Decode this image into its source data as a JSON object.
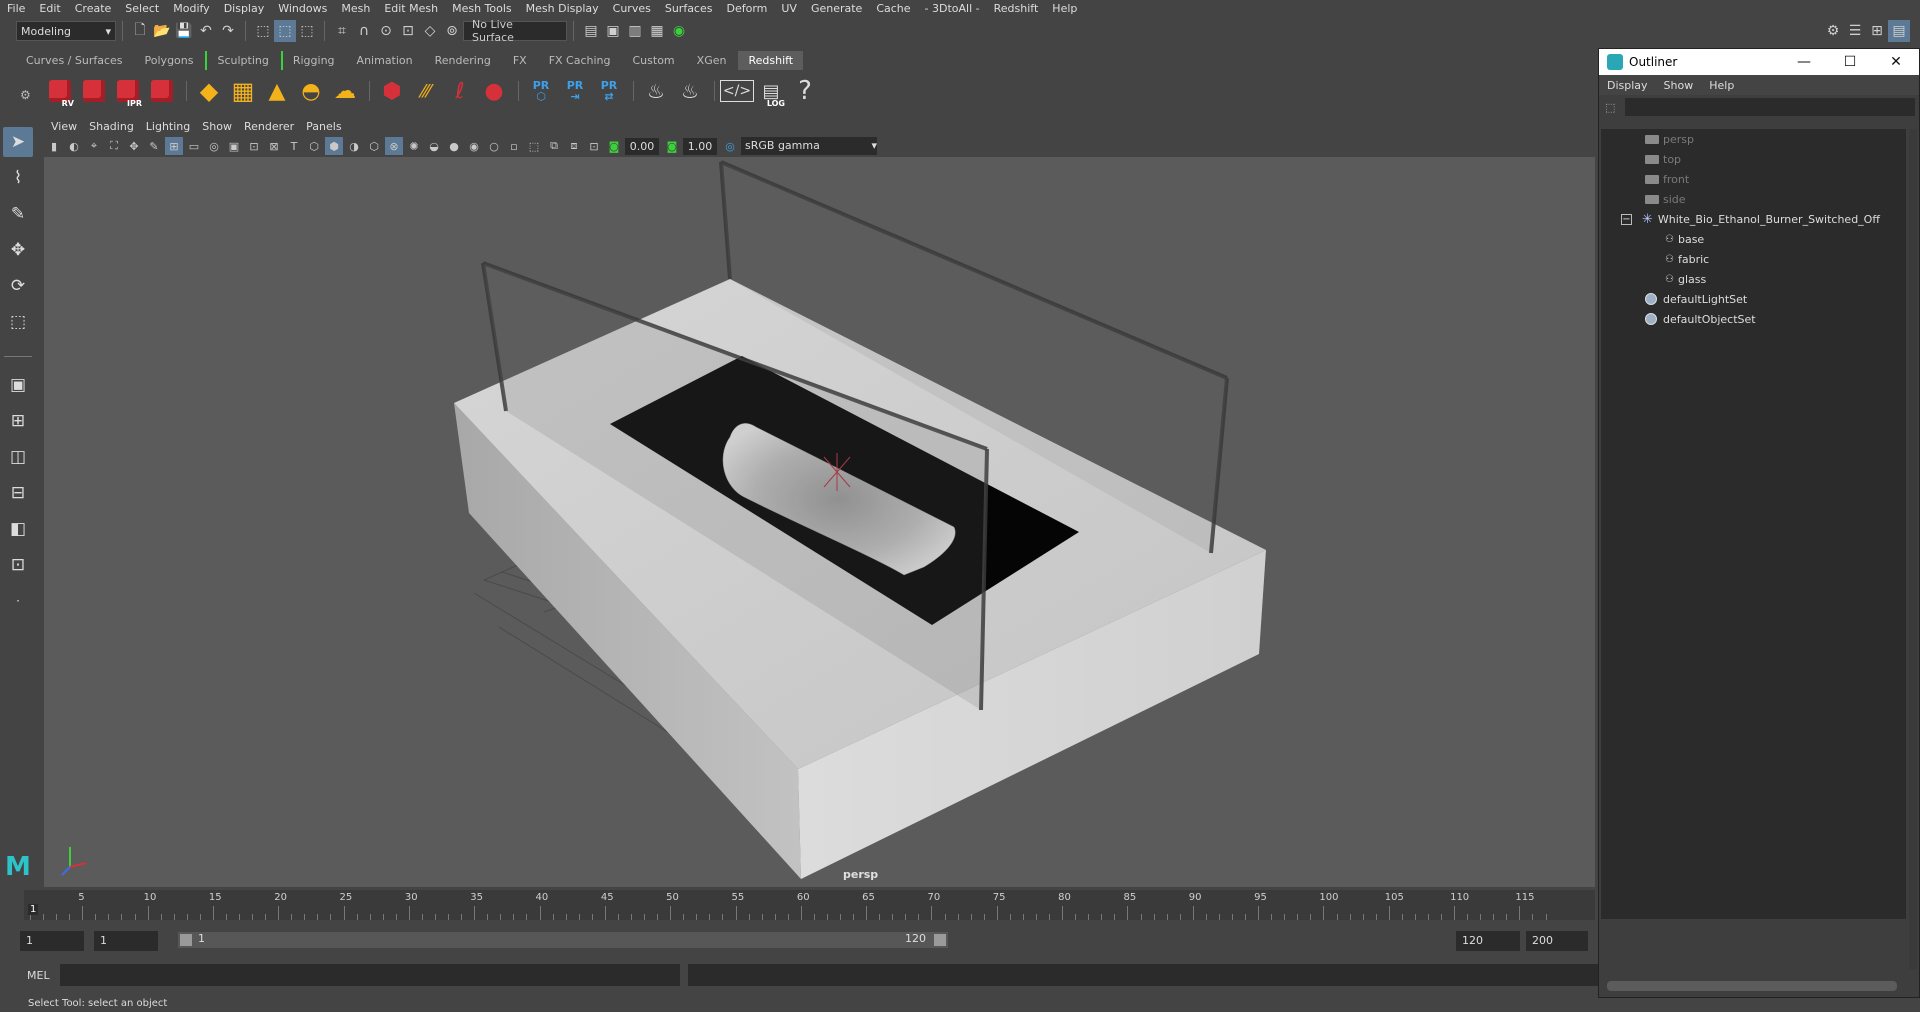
{
  "menubar": [
    "File",
    "Edit",
    "Create",
    "Select",
    "Modify",
    "Display",
    "Windows",
    "Mesh",
    "Edit Mesh",
    "Mesh Tools",
    "Mesh Display",
    "Curves",
    "Surfaces",
    "Deform",
    "UV",
    "Generate",
    "Cache",
    "- 3DtoAll -",
    "Redshift",
    "Help"
  ],
  "statusline": {
    "mode": "Modeling",
    "live_surface": "No Live Surface"
  },
  "shelf_tabs": [
    {
      "label": "Curves / Surfaces",
      "active": false,
      "green": false
    },
    {
      "label": "Polygons",
      "active": false,
      "green": false
    },
    {
      "label": "Sculpting",
      "active": false,
      "green": true
    },
    {
      "label": "Rigging",
      "active": false,
      "green": true
    },
    {
      "label": "Animation",
      "active": false,
      "green": false
    },
    {
      "label": "Rendering",
      "active": false,
      "green": false
    },
    {
      "label": "FX",
      "active": false,
      "green": false
    },
    {
      "label": "FX Caching",
      "active": false,
      "green": false
    },
    {
      "label": "Custom",
      "active": false,
      "green": false
    },
    {
      "label": "XGen",
      "active": false,
      "green": false
    },
    {
      "label": "Redshift",
      "active": true,
      "green": false
    }
  ],
  "shelf": {
    "rv_label": "RV",
    "ipr_label": "IPR",
    "pr_label": "PR",
    "log_label": "LOG",
    "help_glyph": "?"
  },
  "viewport": {
    "menus": [
      "View",
      "Shading",
      "Lighting",
      "Show",
      "Renderer",
      "Panels"
    ],
    "exposure": "0.00",
    "gamma_value": "1.00",
    "color_space": "sRGB gamma",
    "camera_label": "persp"
  },
  "timeslider": {
    "ticks": [
      "5",
      "10",
      "15",
      "20",
      "25",
      "30",
      "35",
      "40",
      "45",
      "50",
      "55",
      "60",
      "65",
      "70",
      "75",
      "80",
      "85",
      "90",
      "95",
      "100",
      "105",
      "110",
      "115"
    ],
    "current_frame": "1"
  },
  "range": {
    "start": "1",
    "anim_start": "1",
    "range_start": "1",
    "range_end": "120",
    "end": "120",
    "anim_end": "200"
  },
  "command": {
    "label": "MEL"
  },
  "helpline": "Select Tool: select an object",
  "outliner": {
    "title": "Outliner",
    "menus": [
      "Display",
      "Show",
      "Help"
    ],
    "items": [
      {
        "label": "persp",
        "type": "camera",
        "dim": true,
        "indent": 1
      },
      {
        "label": "top",
        "type": "camera",
        "dim": true,
        "indent": 1
      },
      {
        "label": "front",
        "type": "camera",
        "dim": true,
        "indent": 1
      },
      {
        "label": "side",
        "type": "camera",
        "dim": true,
        "indent": 1
      },
      {
        "label": "White_Bio_Ethanol_Burner_Switched_Off",
        "type": "group",
        "dim": false,
        "indent": 0
      },
      {
        "label": "base",
        "type": "mesh",
        "dim": false,
        "indent": 2
      },
      {
        "label": "fabric",
        "type": "mesh",
        "dim": false,
        "indent": 2
      },
      {
        "label": "glass",
        "type": "mesh",
        "dim": false,
        "indent": 2
      },
      {
        "label": "defaultLightSet",
        "type": "set",
        "dim": false,
        "indent": 1
      },
      {
        "label": "defaultObjectSet",
        "type": "set",
        "dim": false,
        "indent": 1
      }
    ]
  },
  "colors": {
    "accent": "#5c7a95",
    "shelf_active_green": "#3bd13b",
    "redshift_red": "#d6303a",
    "outliner_icon": "#2aa7b5"
  }
}
